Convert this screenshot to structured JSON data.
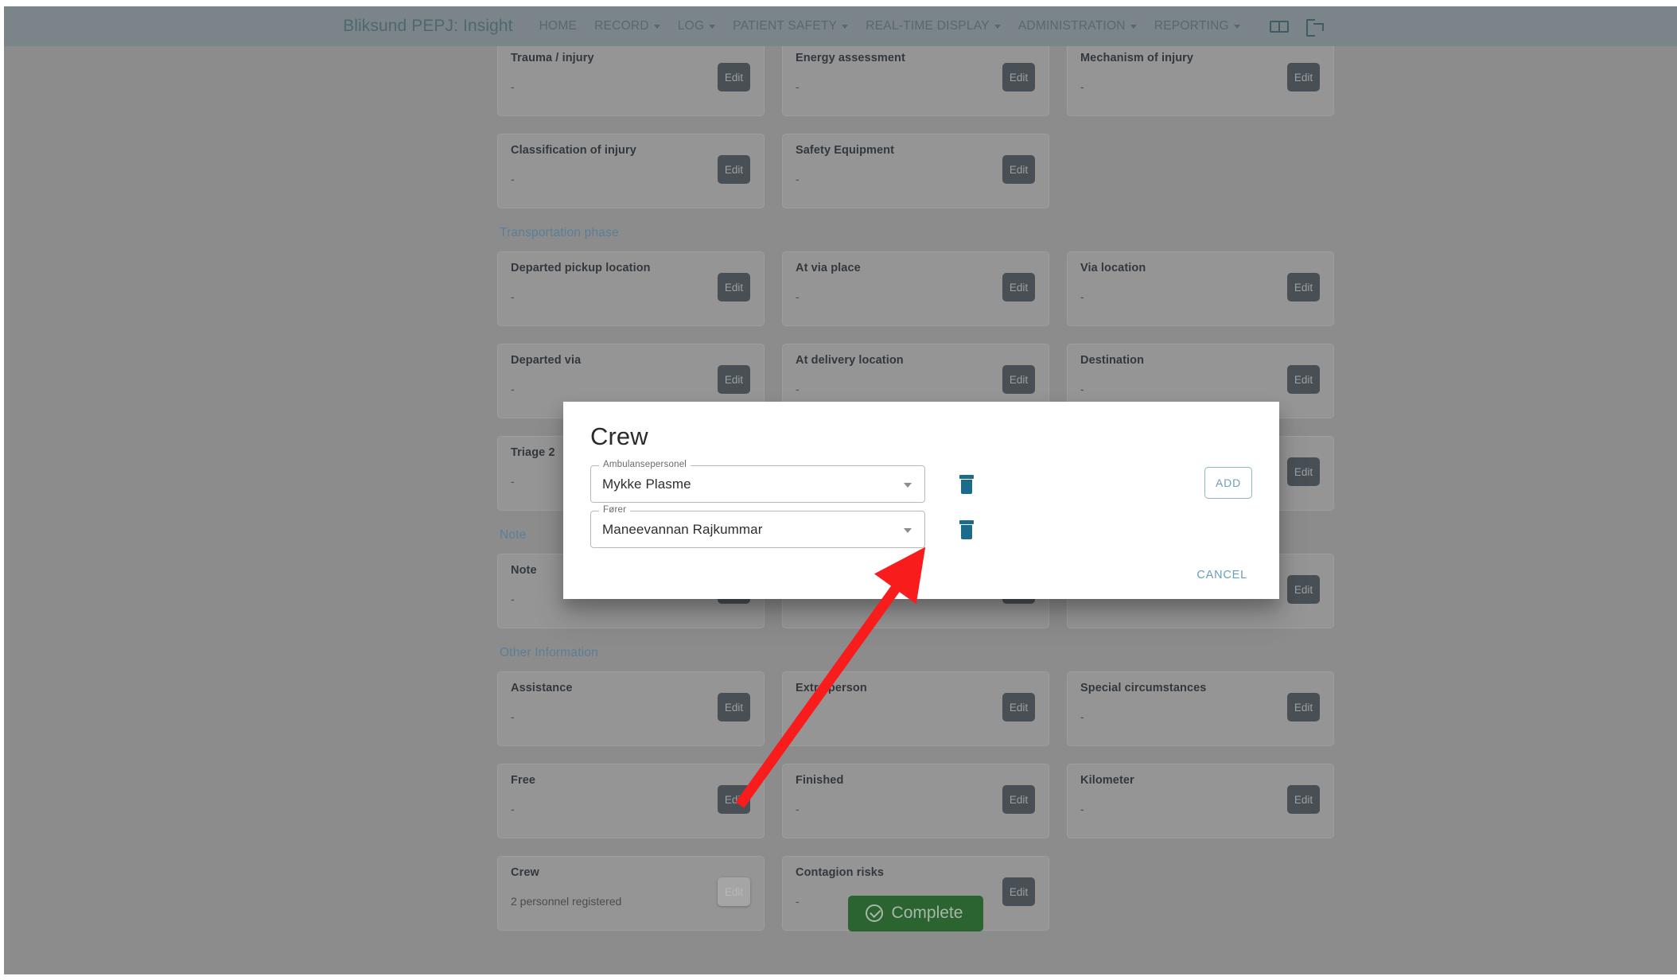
{
  "navbar": {
    "brand": "Bliksund PEPJ: Insight",
    "links": [
      {
        "label": "HOME",
        "caret": false
      },
      {
        "label": "RECORD",
        "caret": true
      },
      {
        "label": "LOG",
        "caret": true
      },
      {
        "label": "PATIENT SAFETY",
        "caret": true
      },
      {
        "label": "REAL-TIME DISPLAY",
        "caret": true
      },
      {
        "label": "ADMINISTRATION",
        "caret": true
      },
      {
        "label": "REPORTING",
        "caret": true
      }
    ],
    "icons": [
      {
        "name": "translate-icon"
      },
      {
        "name": "logout-icon"
      }
    ]
  },
  "sections": [
    {
      "title": "",
      "rows": [
        [
          {
            "title": "Trauma / injury",
            "value": "-",
            "edit": "Edit",
            "active": false
          },
          {
            "title": "Energy assessment",
            "value": "-",
            "edit": "Edit",
            "active": false
          },
          {
            "title": "Mechanism of injury",
            "value": "-",
            "edit": "Edit",
            "active": false
          }
        ],
        [
          {
            "title": "Classification of injury",
            "value": "-",
            "edit": "Edit",
            "active": false
          },
          {
            "title": "Safety Equipment",
            "value": "-",
            "edit": "Edit",
            "active": false
          },
          {
            "empty": true
          }
        ]
      ]
    },
    {
      "title": "Transportation phase",
      "rows": [
        [
          {
            "title": "Departed pickup location",
            "value": "-",
            "edit": "Edit",
            "active": false
          },
          {
            "title": "At via place",
            "value": "-",
            "edit": "Edit",
            "active": false
          },
          {
            "title": "Via location",
            "value": "-",
            "edit": "Edit",
            "active": false
          }
        ],
        [
          {
            "title": "Departed via",
            "value": "-",
            "edit": "Edit",
            "active": false
          },
          {
            "title": "At delivery location",
            "value": "-",
            "edit": "Edit",
            "active": false
          },
          {
            "title": "Destination",
            "value": "-",
            "edit": "Edit",
            "active": false
          }
        ],
        [
          {
            "title": "Triage 2",
            "value": "-",
            "edit": "Edit",
            "active": false
          },
          {
            "title": "",
            "value": "",
            "edit": "Edit",
            "active": false
          },
          {
            "title": "",
            "value": "",
            "edit": "Edit",
            "active": false
          }
        ]
      ]
    },
    {
      "title": "Note",
      "rows": [
        [
          {
            "title": "Note",
            "value": "-",
            "edit": "Edit",
            "active": false
          },
          {
            "title": "",
            "value": "",
            "edit": "Edit",
            "active": false
          },
          {
            "title": "",
            "value": "",
            "edit": "Edit",
            "active": false
          }
        ]
      ]
    },
    {
      "title": "Other Information",
      "rows": [
        [
          {
            "title": "Assistance",
            "value": "-",
            "edit": "Edit",
            "active": false
          },
          {
            "title": "Extra person",
            "value": "-",
            "edit": "Edit",
            "active": false
          },
          {
            "title": "Special circumstances",
            "value": "-",
            "edit": "Edit",
            "active": false
          }
        ],
        [
          {
            "title": "Free",
            "value": "-",
            "edit": "Edit",
            "active": false
          },
          {
            "title": "Finished",
            "value": "-",
            "edit": "Edit",
            "active": false
          },
          {
            "title": "Kilometer",
            "value": "-",
            "edit": "Edit",
            "active": false
          }
        ],
        [
          {
            "title": "Crew",
            "value": "2 personnel registered",
            "edit": "Edit",
            "active": true
          },
          {
            "title": "Contagion risks",
            "value": "-",
            "edit": "Edit",
            "active": false
          },
          {
            "empty": true
          }
        ]
      ]
    }
  ],
  "footer": {
    "complete_label": "Complete"
  },
  "modal": {
    "title": "Crew",
    "rows": [
      {
        "label": "Ambulansepersonel",
        "value": "Mykke Plasme"
      },
      {
        "label": "Fører",
        "value": "Maneevannan Rajkummar"
      }
    ],
    "add_label": "ADD",
    "cancel_label": "CANCEL"
  },
  "colors": {
    "navbar_bg": "#7b8589",
    "page_overlay": "#8c8c8c",
    "brand_text": "#4e686f",
    "section_title": "#5b7f99",
    "card_bg": "#959595",
    "edit_btn": "#484f55",
    "complete_btn": "#2b6430",
    "trash_icon": "#1b6c8c",
    "modal_accent": "#63a0bd",
    "annotation_arrow": "#f81c1c"
  }
}
